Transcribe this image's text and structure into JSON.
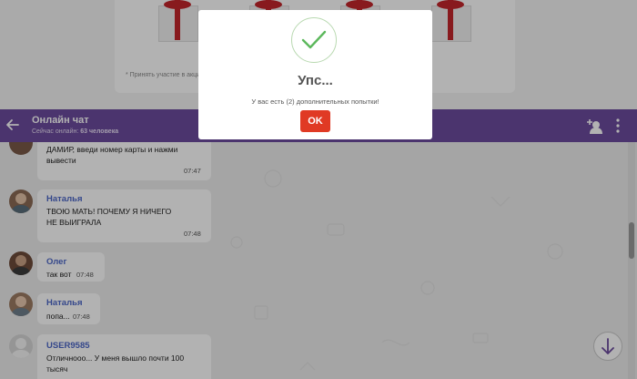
{
  "promo": {
    "note": "* Принять участие в акции м"
  },
  "header": {
    "title": "Онлайн чат",
    "online_prefix": "Сейчас онлайн:",
    "online_count": "63 человека"
  },
  "messages": [
    {
      "name": "",
      "text": "ДАМИР, введи номер карты и нажми вывести",
      "time": "07:47"
    },
    {
      "name": "Наталья",
      "text": "ТВОЮ МАТЬ! ПОЧЕМУ Я НИЧЕГО НЕ ВЫИГРАЛА",
      "time": "07:48"
    },
    {
      "name": "Олег",
      "text": "так вот",
      "time": "07:48"
    },
    {
      "name": "Наталья",
      "text": "попа...",
      "time": "07:48"
    },
    {
      "name": "USER9585",
      "text": "Отличнооо... У меня вышло почти 100 тысяч",
      "time": ""
    }
  ],
  "modal": {
    "title": "Упс...",
    "message": "У вас есть (2) дополнительных попытки!",
    "ok_label": "OK"
  },
  "colors": {
    "header": "#6c4b9e",
    "name": "#4d67c8",
    "ok_button": "#e03a24",
    "check": "#5cb85c"
  },
  "icons": [
    "back-arrow-icon",
    "add-user-icon",
    "more-vert-icon",
    "check-icon",
    "arrow-down-icon",
    "gift-icon"
  ]
}
